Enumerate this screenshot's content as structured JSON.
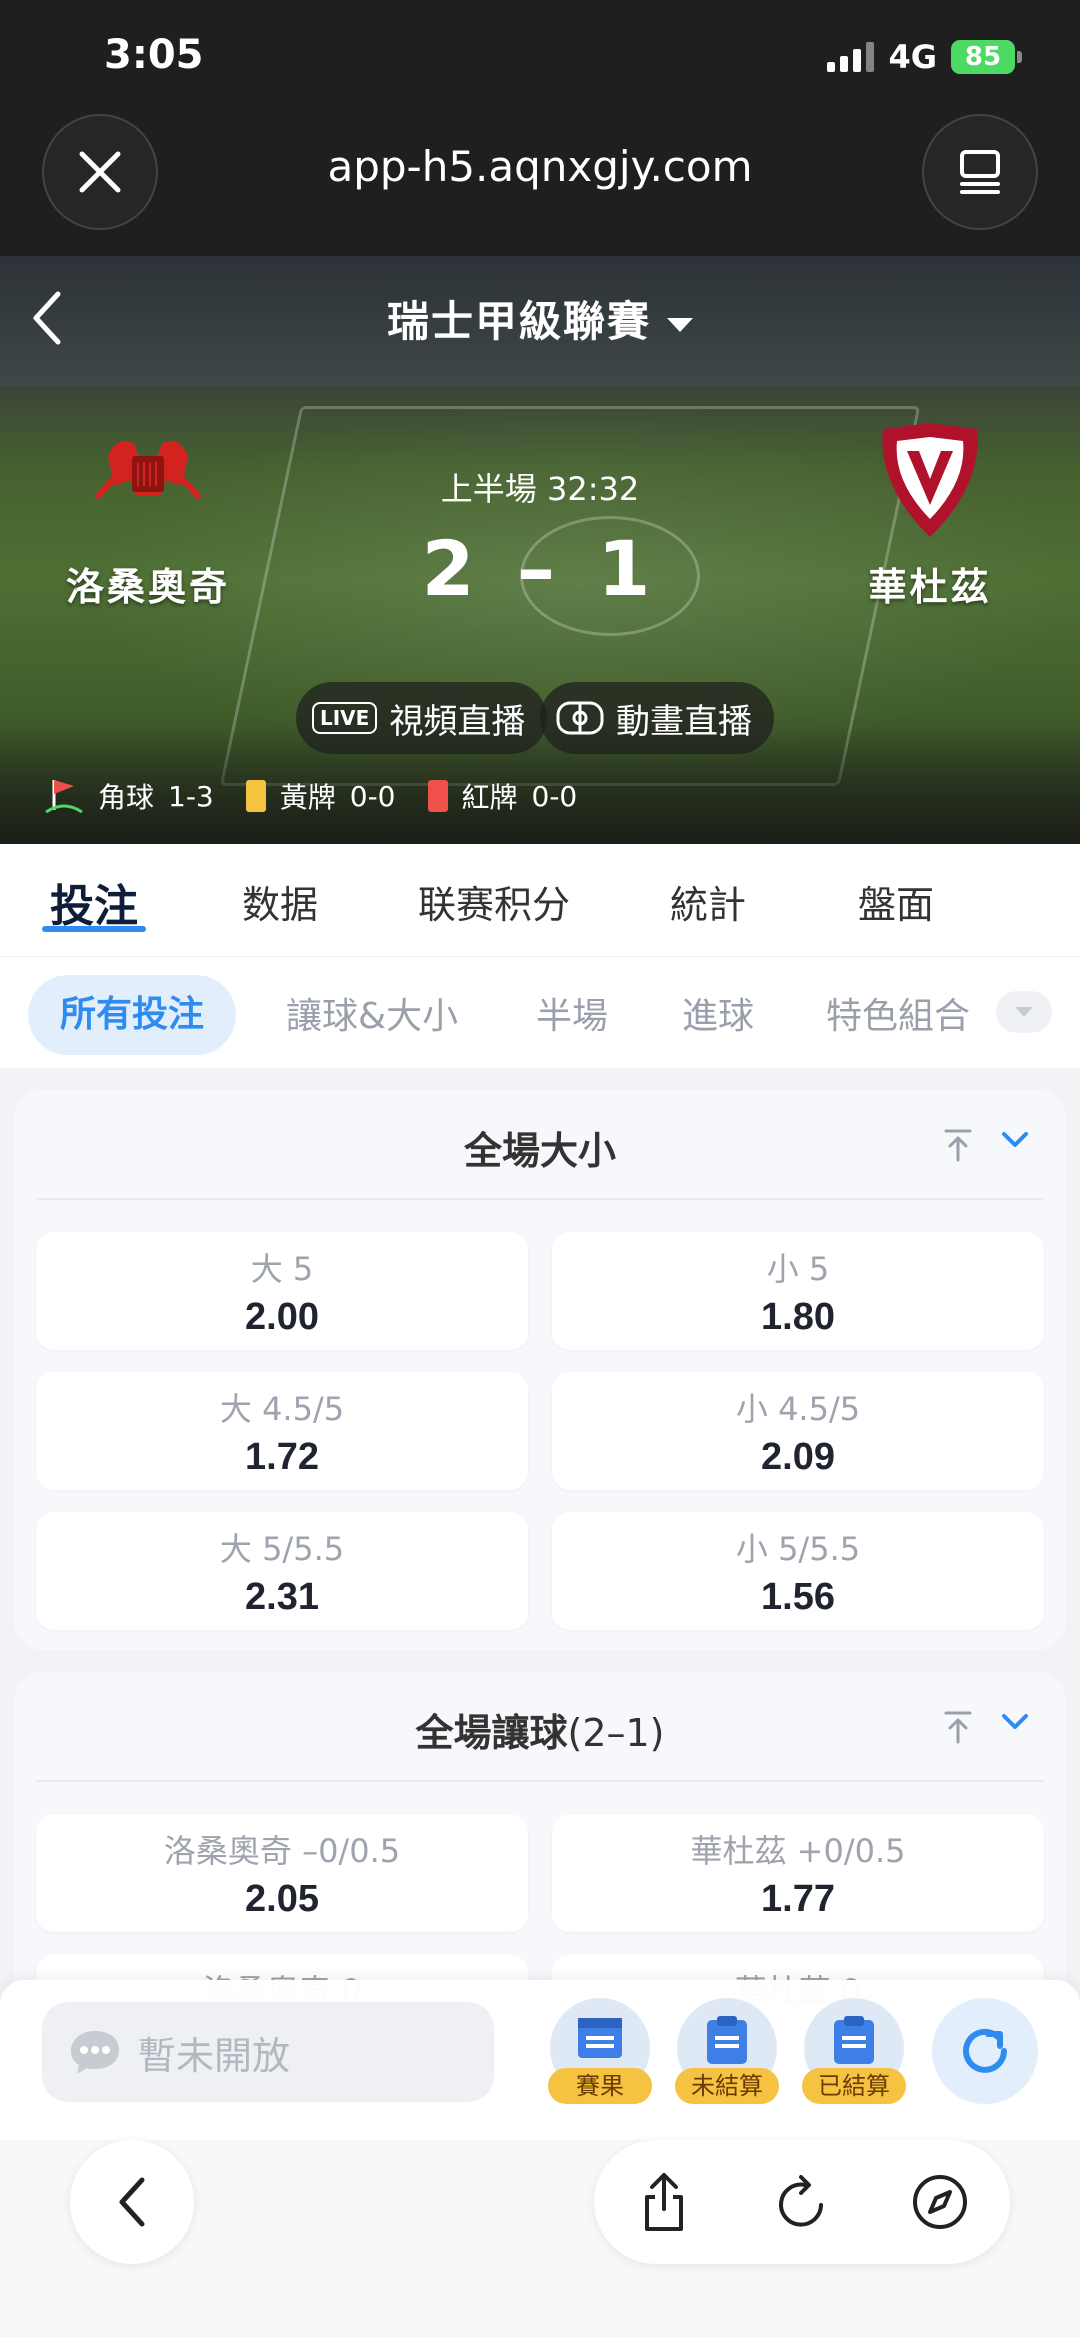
{
  "status_bar": {
    "time": "3:05",
    "network": "4G",
    "battery": "85"
  },
  "browser": {
    "url": "app-h5.aqnxgjy.com"
  },
  "match": {
    "league": "瑞士甲級聯賽",
    "home_team": "洛桑奧奇",
    "away_team": "華杜茲",
    "period_time": "上半場 32:32",
    "score": "2 – 1",
    "video_live_label": "視頻直播",
    "video_live_tag": "LIVE",
    "animation_live_label": "動畫直播",
    "corners_label": "角球",
    "corners_value": "1-3",
    "yellow_label": "黃牌",
    "yellow_value": "0-0",
    "red_label": "紅牌",
    "red_value": "0-0",
    "home_logo_text": "FC STADE LAUSANNE OUCHY",
    "away_logo_text": "V"
  },
  "main_tabs": [
    "投注",
    "数据",
    "联赛积分",
    "統計",
    "盤面"
  ],
  "sub_tabs": [
    "所有投注",
    "讓球&大小",
    "半場",
    "進球",
    "特色組合"
  ],
  "markets": [
    {
      "title": "全場大小",
      "subtitle": "",
      "rows": [
        [
          {
            "label": "大 5",
            "odds": "2.00"
          },
          {
            "label": "小 5",
            "odds": "1.80"
          }
        ],
        [
          {
            "label": "大 4.5/5",
            "odds": "1.72"
          },
          {
            "label": "小 4.5/5",
            "odds": "2.09"
          }
        ],
        [
          {
            "label": "大 5/5.5",
            "odds": "2.31"
          },
          {
            "label": "小 5/5.5",
            "odds": "1.56"
          }
        ]
      ]
    },
    {
      "title": "全場讓球",
      "subtitle": "(2–1)",
      "rows": [
        [
          {
            "label": "洛桑奧奇 –0/0.5",
            "odds": "2.05"
          },
          {
            "label": "華杜茲 +0/0.5",
            "odds": "1.77"
          }
        ],
        [
          {
            "label": "洛桑奧奇 0",
            "odds": ""
          },
          {
            "label": "華杜茲 0",
            "odds": ""
          }
        ]
      ]
    }
  ],
  "bottom": {
    "chat_placeholder": "暫未開放",
    "results_label": "賽果",
    "unsettled_label": "未結算",
    "settled_label": "已結算"
  },
  "colors": {
    "accent": "#2e8cf0",
    "battery": "#4cd964",
    "yellow_card": "#f5c242",
    "red_card": "#f0504a",
    "tag": "#f5c242"
  }
}
